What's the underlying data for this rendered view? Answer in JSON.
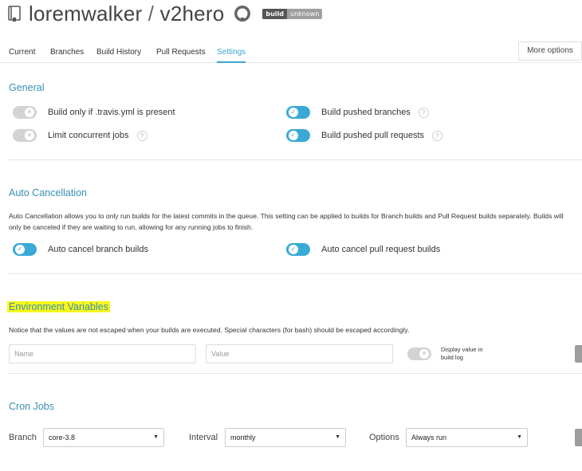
{
  "header": {
    "owner": "loremwalker",
    "separator": "/",
    "repo": "v2hero",
    "badge_left": "build",
    "badge_right": "unknown"
  },
  "tabs": [
    {
      "label": "Current"
    },
    {
      "label": "Branches"
    },
    {
      "label": "Build History"
    },
    {
      "label": "Pull Requests"
    },
    {
      "label": "Settings",
      "active": true
    }
  ],
  "more_options": "More options",
  "general": {
    "title": "General",
    "settings": [
      {
        "label": "Build only if .travis.yml is present",
        "on": false,
        "help": false
      },
      {
        "label": "Limit concurrent jobs",
        "on": false,
        "help": true
      },
      {
        "label": "Build pushed branches",
        "on": true,
        "help": true
      },
      {
        "label": "Build pushed pull requests",
        "on": true,
        "help": true
      }
    ]
  },
  "auto_cancellation": {
    "title": "Auto Cancellation",
    "description": "Auto Cancellation allows you to only run builds for the latest commits in the queue. This setting can be applied to builds for Branch builds and Pull Request builds separately. Builds will only be canceled if they are waiting to run, allowing for any running jobs to finish.",
    "settings": [
      {
        "label": "Auto cancel branch builds",
        "on": true
      },
      {
        "label": "Auto cancel pull request builds",
        "on": true
      }
    ]
  },
  "env_vars": {
    "title": "Environment Variables",
    "description": "Notice that the values are not escaped when your builds are executed. Special characters (for bash) should be escaped accordingly.",
    "name_placeholder": "Name",
    "value_placeholder": "Value",
    "display_label_1": "Display value in",
    "display_label_2": "build log",
    "display_on": false
  },
  "cron": {
    "title": "Cron Jobs",
    "branch_label": "Branch",
    "branch_value": "core-3.8",
    "interval_label": "Interval",
    "interval_value": "monthly",
    "options_label": "Options",
    "options_value": "Always run"
  },
  "colors": {
    "accent": "#39a9d5",
    "section_title": "#3a8fb7",
    "highlight": "#f7f71a"
  },
  "icons": {
    "repo": "repo-book-icon",
    "github": "github-octocat-icon",
    "toggle_on": "check-icon",
    "toggle_off": "x-icon",
    "help": "question-mark-icon",
    "dropdown": "caret-down-icon"
  }
}
